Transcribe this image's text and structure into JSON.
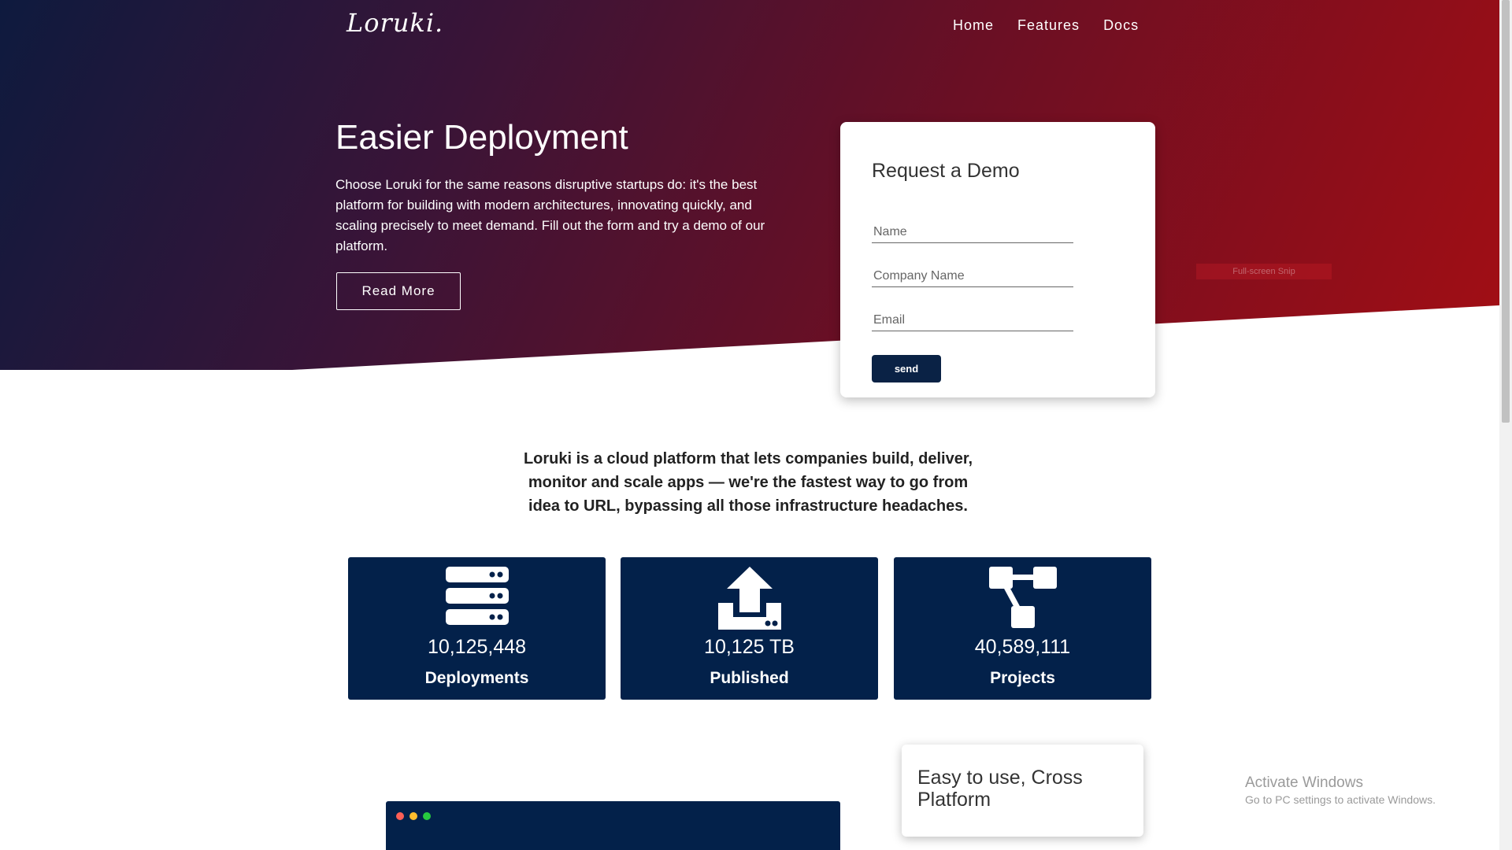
{
  "nav": {
    "logo": "Loruki.",
    "links": [
      "Home",
      "Features",
      "Docs"
    ]
  },
  "hero": {
    "title": "Easier Deployment",
    "text": "Choose Loruki for the same reasons disruptive startups do: it's the best platform for building with modern architectures, innovating quickly, and scaling precisely to meet demand. Fill out the form and try a demo of our platform.",
    "button": "Read More"
  },
  "demo_form": {
    "title": "Request a Demo",
    "name_placeholder": "Name",
    "company_placeholder": "Company Name",
    "email_placeholder": "Email",
    "submit_label": "send"
  },
  "snip_tooltip": "Full-screen Snip",
  "intro": "Loruki is a cloud platform that lets companies build, deliver, monitor and scale apps — we're the fastest way to go from idea to URL, bypassing all those infrastructure headaches.",
  "stats": [
    {
      "number": "10,125,448",
      "label": "Deployments",
      "icon": "server-icon"
    },
    {
      "number": "10,125 TB",
      "label": "Published",
      "icon": "upload-icon"
    },
    {
      "number": "40,589,111",
      "label": "Projects",
      "icon": "project-diagram-icon"
    }
  ],
  "feature_card": {
    "title": "Easy to use, Cross Platform"
  },
  "watermark": {
    "line1": "Activate Windows",
    "line2": "Go to PC settings to activate Windows."
  },
  "colors": {
    "navy": "#03214a",
    "hero_start": "#0e1a3e",
    "hero_end": "#a30e14",
    "dot_red": "#ff5f56",
    "dot_yellow": "#ffbd2e",
    "dot_green": "#27c93f"
  }
}
